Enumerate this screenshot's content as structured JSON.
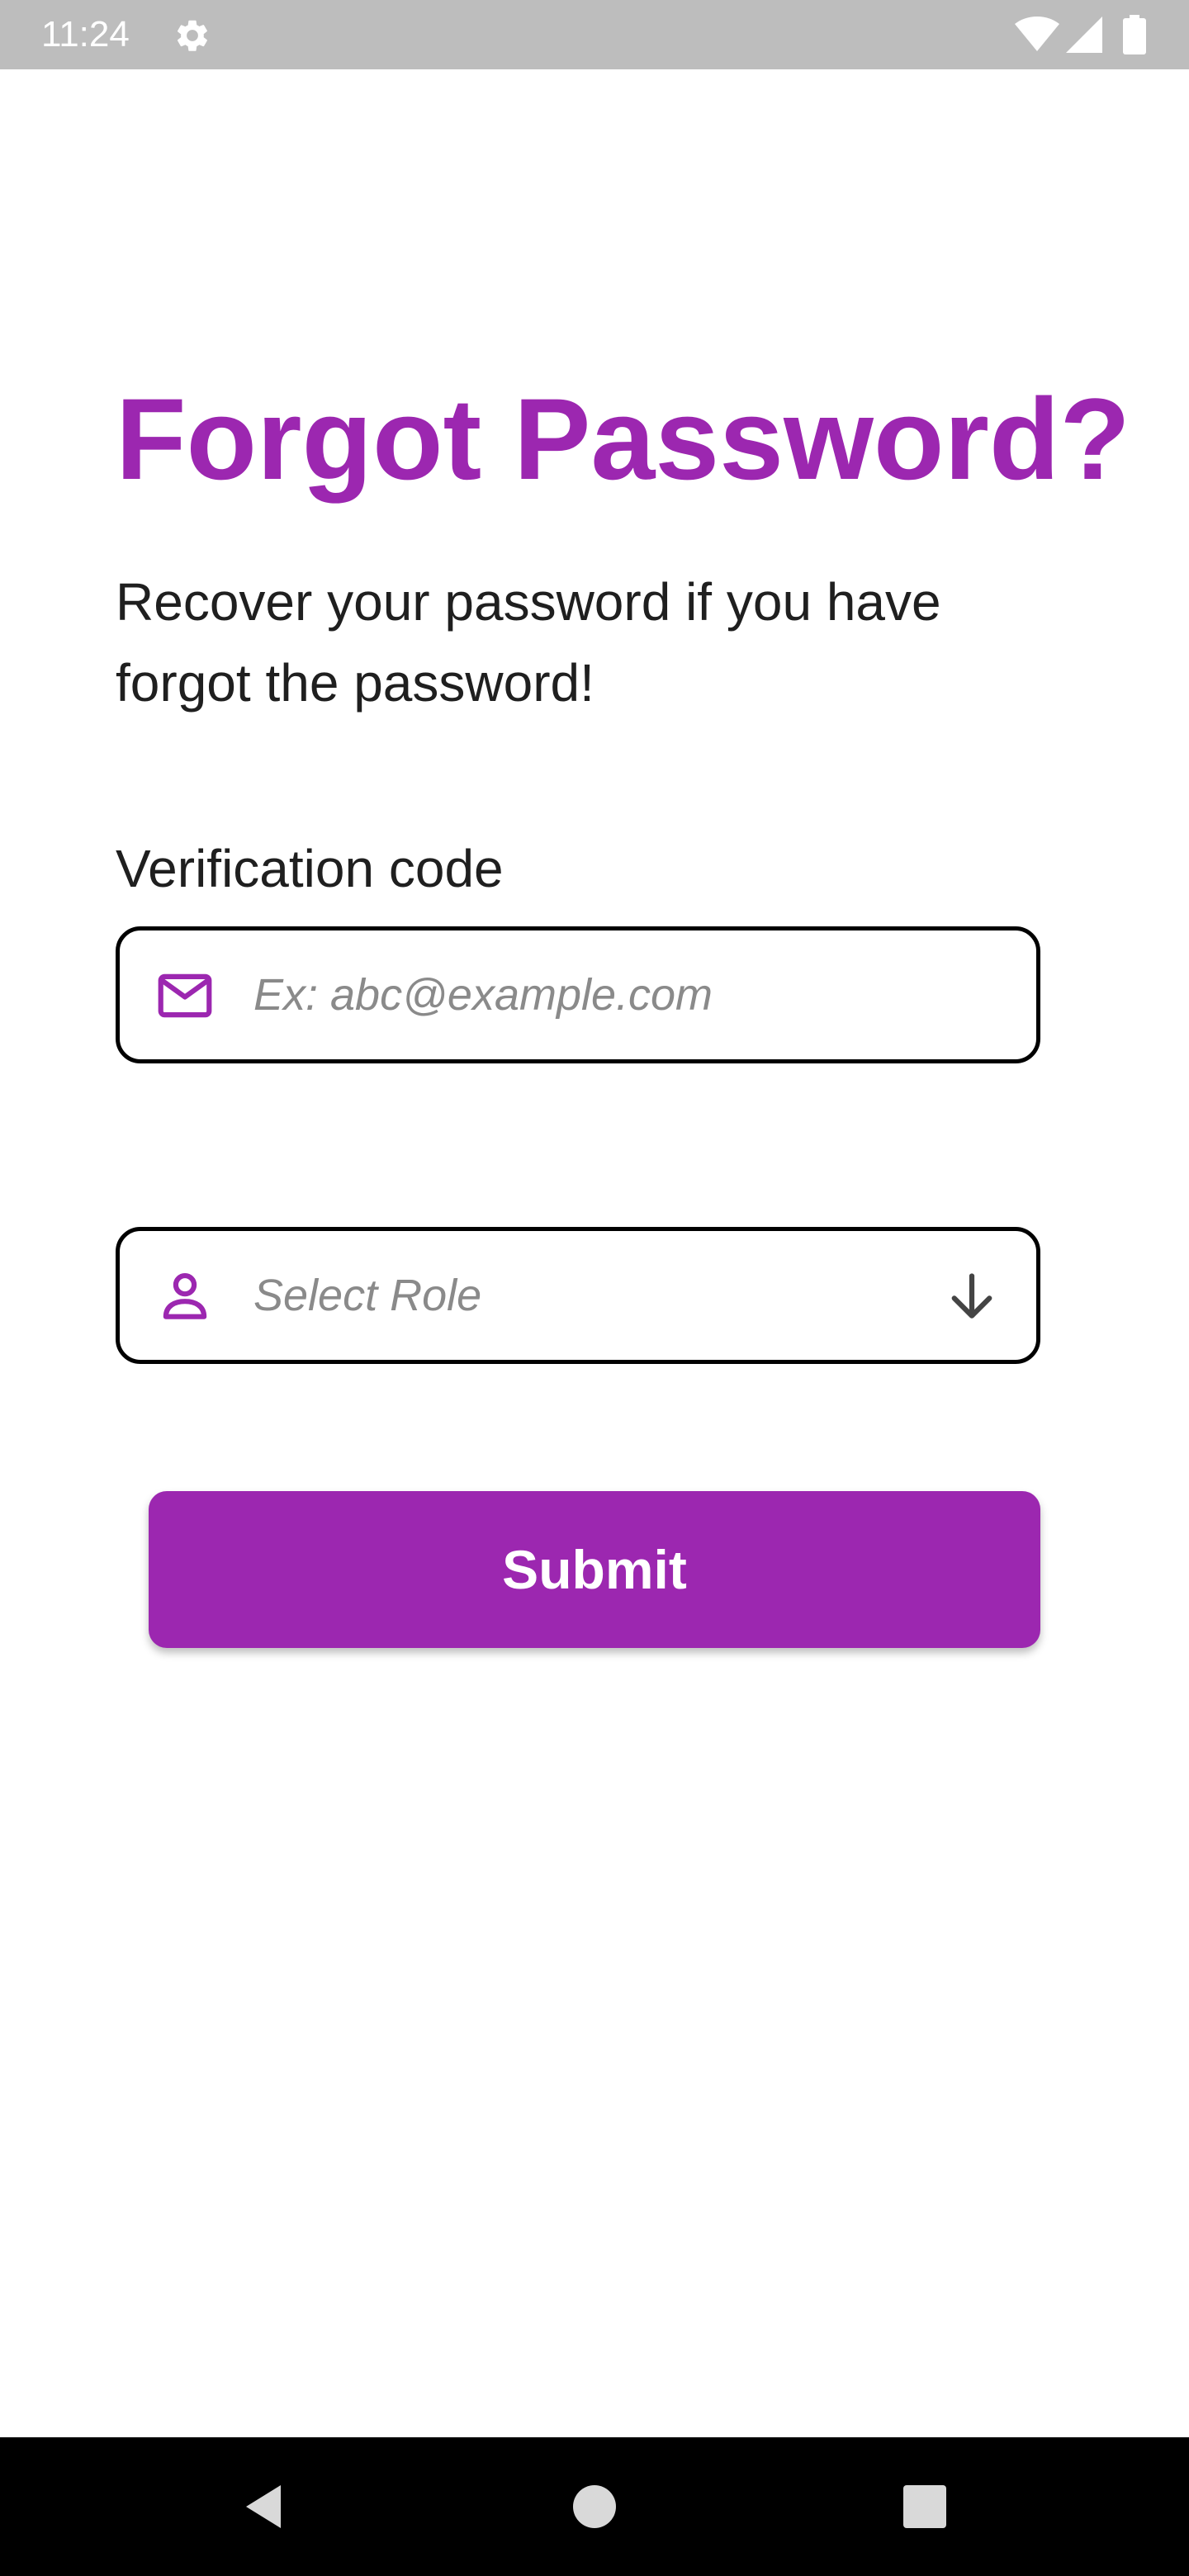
{
  "status_bar": {
    "time": "11:24",
    "icons": [
      "gear-icon",
      "wifi-icon",
      "signal-icon",
      "battery-icon"
    ]
  },
  "page": {
    "title": "Forgot Password?",
    "subtitle": "Recover your password if you have forgot the password!"
  },
  "form": {
    "code_label": "Verification code",
    "email_field": {
      "icon": "mail-icon",
      "value": "",
      "placeholder": "Ex: abc@example.com"
    },
    "role_select": {
      "icon": "person-icon",
      "value": "Select Role",
      "trailing_icon": "arrow-down-icon"
    },
    "submit_label": "Submit"
  },
  "nav_bar": {
    "buttons": [
      "back-icon",
      "home-icon",
      "recents-icon"
    ]
  },
  "colors": {
    "accent": "#9c27b0",
    "status_bar": "#bdbdbd",
    "nav_bar": "#000000",
    "placeholder": "#8a8a8a",
    "text": "#1f1f1f"
  }
}
